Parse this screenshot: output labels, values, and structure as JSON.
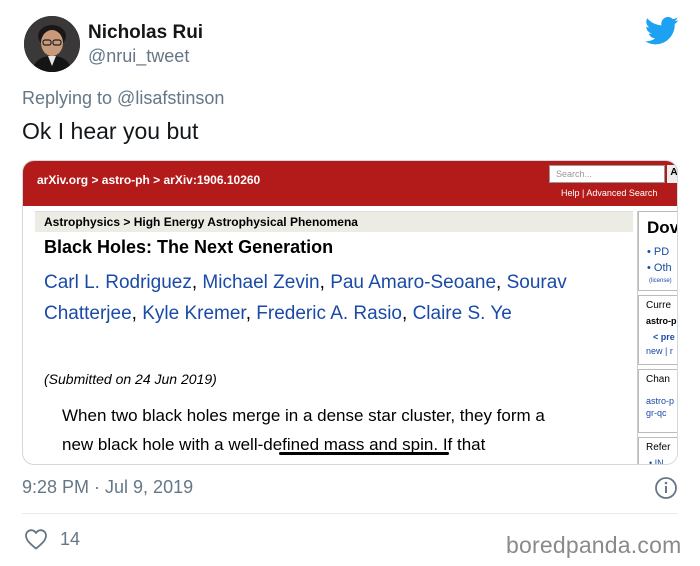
{
  "tweet": {
    "author_name": "Nicholas Rui",
    "author_handle": "@nrui_tweet",
    "replying_to": "Replying to @lisafstinson",
    "text": "Ok I hear you but",
    "timestamp": "9:28 PM · Jul 9, 2019",
    "like_count": "14"
  },
  "icons": {
    "platform": "twitter-bird-icon",
    "info": "info-icon",
    "like": "heart-icon"
  },
  "colors": {
    "twitter_blue": "#1da1f2",
    "muted_text": "#657786",
    "arxiv_red": "#b31b1b",
    "link_blue": "#1a4aa8"
  },
  "embedded_page": {
    "breadcrumb": "arXiv.org > astro-ph > arXiv:1906.10260",
    "search_placeholder": "Search...",
    "search_button": "A",
    "help_links": "Help | Advanced Search",
    "subject": "Astrophysics > High Energy Astrophysical Phenomena",
    "title": "Black Holes: The Next Generation",
    "authors": [
      "Carl L. Rodriguez",
      "Michael Zevin",
      "Pau Amaro-Seoane",
      "Sourav Chatterjee",
      "Kyle Kremer",
      "Frederic A. Rasio",
      "Claire S. Ye"
    ],
    "submitted": "(Submitted on 24 Jun 2019)",
    "abstract_line1": "When two black holes merge in a dense star cluster, they form a",
    "abstract_line2": "new black hole with a well-defined mass and spin. If that",
    "sidebar": {
      "download_heading": "Dov",
      "download_items": [
        "PD",
        "Oth"
      ],
      "license": "(license)",
      "current_heading": "Curre",
      "current_category": "astro-p",
      "current_prev": "< pre",
      "current_new": "new | r",
      "change_heading": "Chan",
      "change_items": [
        "astro-p",
        "gr-qc"
      ],
      "refs_heading": "Refer",
      "refs_item": "IN"
    }
  },
  "watermark": "boredpanda.com"
}
